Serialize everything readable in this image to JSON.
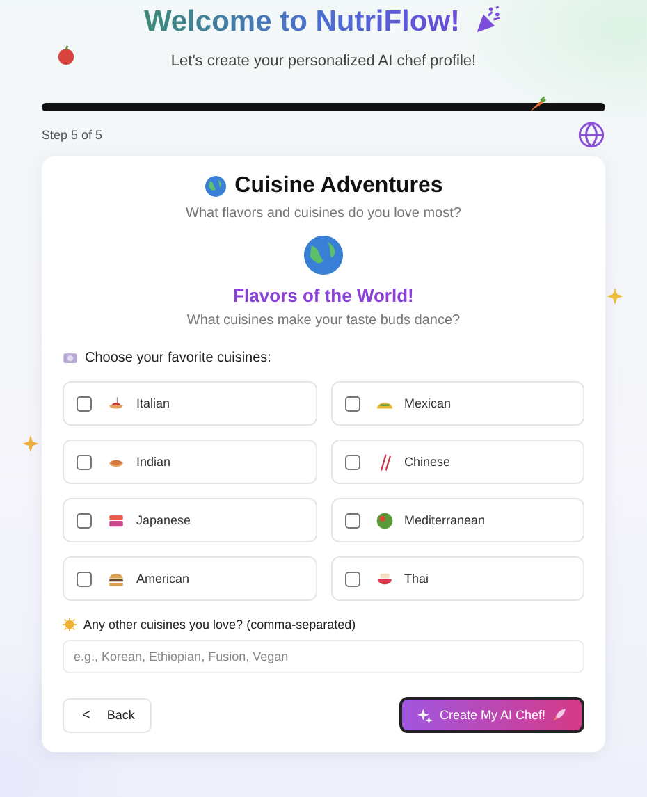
{
  "header": {
    "title": "Welcome to NutriFlow!",
    "subtitle": "Let's create your personalized AI chef profile!"
  },
  "progress": {
    "level": 1.0,
    "step": "Step 5 of 5"
  },
  "card": {
    "title": "Cuisine Adventures",
    "subtitle": "What flavors and cuisines do you love most?",
    "heading": "Flavors of the World!",
    "prompt": "What cuisines make your taste buds dance?",
    "choose_label": "Choose your favorite cuisines:",
    "cuisines": [
      {
        "label": "Italian",
        "checked": false
      },
      {
        "label": "Mexican",
        "checked": false
      },
      {
        "label": "Indian",
        "checked": false
      },
      {
        "label": "Chinese",
        "checked": false
      },
      {
        "label": "Japanese",
        "checked": false
      },
      {
        "label": "Mediterranean",
        "checked": false
      },
      {
        "label": "American",
        "checked": false
      },
      {
        "label": "Thai",
        "checked": false
      }
    ],
    "other_label": "Any other cuisines you love? (comma-separated)",
    "other_placeholder": "e.g., Korean, Ethiopian, Fusion, Vegan",
    "back_icon": "<",
    "back": "Back",
    "create": "Create My AI Chef!"
  }
}
